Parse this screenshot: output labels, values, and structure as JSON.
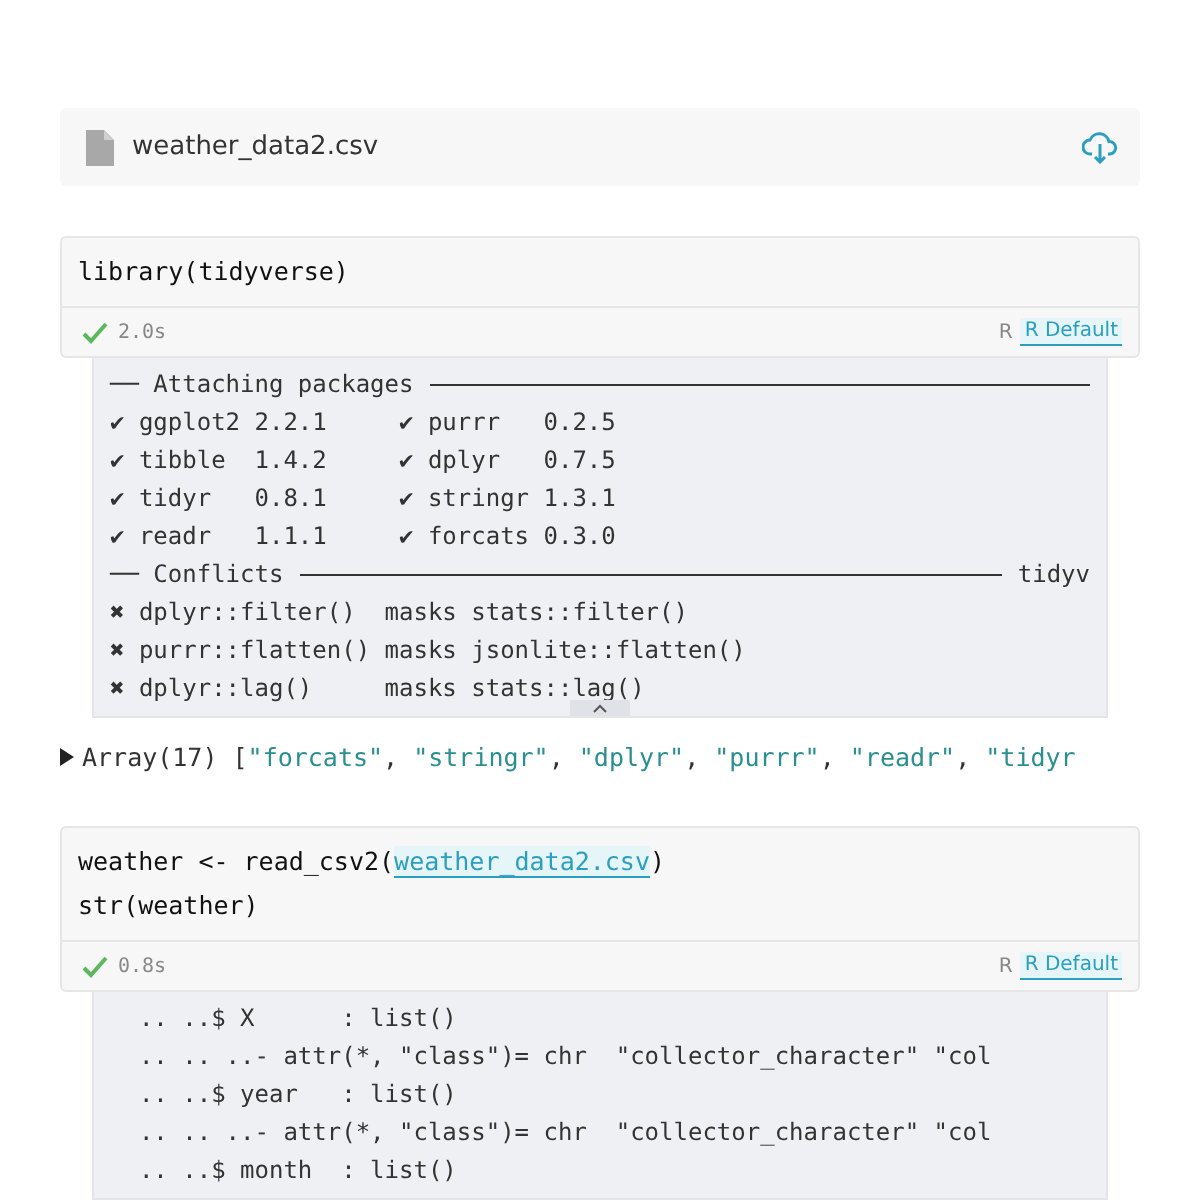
{
  "file_card": {
    "name": "weather_data2.csv"
  },
  "cells": [
    {
      "code": [
        [
          {
            "kind": "plain",
            "text": "library(tidyverse)"
          }
        ]
      ],
      "status": {
        "ok": true,
        "time": "2.0s",
        "language": "R",
        "kernel": "R Default"
      },
      "output": {
        "collapsible": true,
        "lines": [
          {
            "kind": "rule",
            "text": "── Attaching packages"
          },
          {
            "kind": "text",
            "text": "✔ ggplot2 2.2.1     ✔ purrr   0.2.5"
          },
          {
            "kind": "text",
            "text": "✔ tibble  1.4.2     ✔ dplyr   0.7.5"
          },
          {
            "kind": "text",
            "text": "✔ tidyr   0.8.1     ✔ stringr 1.3.1"
          },
          {
            "kind": "text",
            "text": "✔ readr   1.1.1     ✔ forcats 0.3.0"
          },
          {
            "kind": "rule",
            "text": "── Conflicts",
            "suffix": "tidyv"
          },
          {
            "kind": "text",
            "text": "✖ dplyr::filter()  masks stats::filter()"
          },
          {
            "kind": "text",
            "text": "✖ purrr::flatten() masks jsonlite::flatten()"
          },
          {
            "kind": "text",
            "text": "✖ dplyr::lag()     masks stats::lag()"
          }
        ]
      }
    },
    {
      "code": [
        [
          {
            "kind": "plain",
            "text": "weather <- read_csv2("
          },
          {
            "kind": "link",
            "text": "weather_data2.csv"
          },
          {
            "kind": "plain",
            "text": ")"
          }
        ],
        [
          {
            "kind": "plain",
            "text": "str(weather)"
          }
        ]
      ],
      "status": {
        "ok": true,
        "time": "0.8s",
        "language": "R",
        "kernel": "R Default"
      },
      "output": {
        "lines": [
          {
            "kind": "text",
            "text": "  .. ..$ X      : list()"
          },
          {
            "kind": "text",
            "text": "  .. .. ..- attr(*, \"class\")= chr  \"collector_character\" \"col"
          },
          {
            "kind": "text",
            "text": "  .. ..$ year   : list()"
          },
          {
            "kind": "text",
            "text": "  .. .. ..- attr(*, \"class\")= chr  \"collector_character\" \"col"
          },
          {
            "kind": "text",
            "text": "  .. ..$ month  : list()"
          }
        ]
      }
    }
  ],
  "array_preview": {
    "expanded": false,
    "tokens": [
      {
        "kind": "plain",
        "text": "Array(17) ["
      },
      {
        "kind": "string",
        "text": "\"forcats\""
      },
      {
        "kind": "plain",
        "text": ", "
      },
      {
        "kind": "string",
        "text": "\"stringr\""
      },
      {
        "kind": "plain",
        "text": ", "
      },
      {
        "kind": "string",
        "text": "\"dplyr\""
      },
      {
        "kind": "plain",
        "text": ", "
      },
      {
        "kind": "string",
        "text": "\"purrr\""
      },
      {
        "kind": "plain",
        "text": ", "
      },
      {
        "kind": "string",
        "text": "\"readr\""
      },
      {
        "kind": "plain",
        "text": ", "
      },
      {
        "kind": "string",
        "text": "\"tidyr"
      }
    ]
  }
}
